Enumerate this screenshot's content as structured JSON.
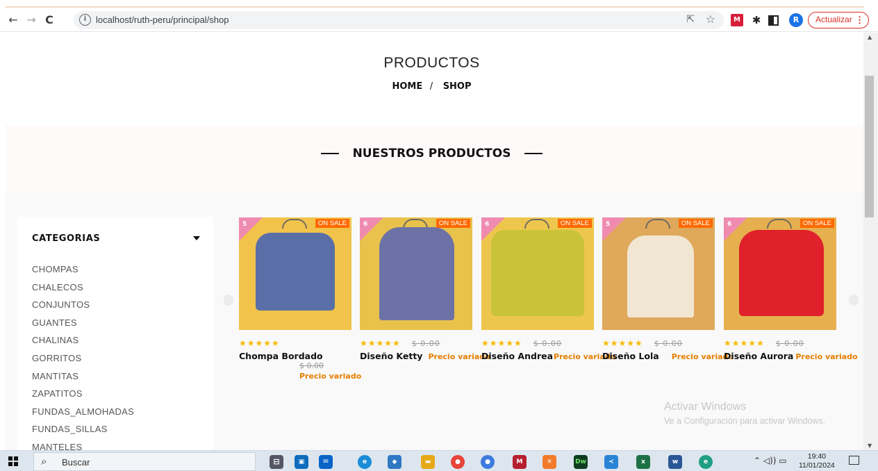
{
  "browser": {
    "url": "localhost/ruth-peru/principal/shop",
    "update_label": "Actualizar",
    "avatar_letter": "R",
    "ext_red_label": "M"
  },
  "page": {
    "title": "PRODUCTOS",
    "breadcrumb": {
      "home": "HOME",
      "separator": "/",
      "current": "SHOP"
    },
    "section_title": "NUESTROS PRODUCTOS"
  },
  "sidebar": {
    "heading": "CATEGORIAS",
    "categories": [
      "CHOMPAS",
      "CHALECOS",
      "CONJUNTOS",
      "GUANTES",
      "CHALINAS",
      "GORRITOS",
      "MANTITAS",
      "ZAPATITOS",
      "FUNDAS_ALMOHADAS",
      "FUNDAS_SILLAS",
      "MANTELES"
    ]
  },
  "products": [
    {
      "name": "Chompa Bordado",
      "stars": "★★★★★",
      "old_price": "$ 0.00",
      "price_note": "Precio variado",
      "badge": "ON SALE",
      "corner": "5",
      "bg": "#f1c34a",
      "garment": "#5a6fa8"
    },
    {
      "name": "Diseño Ketty",
      "stars": "★★★★★",
      "old_price": "$ 0.00",
      "price_note": "Precio variado",
      "badge": "ON SALE",
      "corner": "6",
      "bg": "#e9c24c",
      "garment": "#6d72a6"
    },
    {
      "name": "Diseño Andrea",
      "stars": "★★★★★",
      "old_price": "$ 0.00",
      "price_note": "Precio variado",
      "badge": "ON SALE",
      "corner": "6",
      "bg": "#eec64d",
      "garment": "#c9c33a"
    },
    {
      "name": "Diseño Lola",
      "stars": "★★★★★",
      "old_price": "$ 0.00",
      "price_note": "Precio variado",
      "badge": "ON SALE",
      "corner": "5",
      "bg": "#e0a85a",
      "garment": "#f1e6d2"
    },
    {
      "name": "Diseño Aurora",
      "stars": "★★★★★",
      "old_price": "$ 0.00",
      "price_note": "Precio variado",
      "badge": "ON SALE",
      "corner": "6",
      "bg": "#e6b04e",
      "garment": "#e0202a"
    }
  ],
  "watermark": {
    "line1": "Activar Windows",
    "line2": "Ve a Configuración para activar Windows."
  },
  "taskbar": {
    "search_placeholder": "Buscar",
    "time": "19:40",
    "date": "11/01/2024",
    "dw_label": "Dw",
    "xl_label": "x",
    "wd_label": "w",
    "e_label": "e"
  },
  "colors": {
    "accent_orange": "#ff6a00",
    "price_orange": "#e67e00",
    "star_yellow": "#f7bb00",
    "update_red": "#d93025"
  }
}
